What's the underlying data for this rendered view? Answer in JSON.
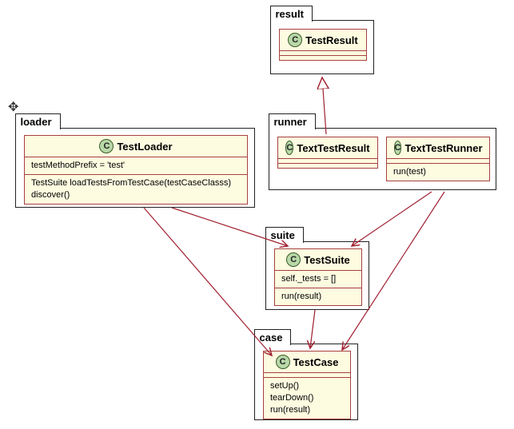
{
  "packages": {
    "result": {
      "label": "result"
    },
    "loader": {
      "label": "loader"
    },
    "runner": {
      "label": "runner"
    },
    "suite": {
      "label": "suite"
    },
    "case": {
      "label": "case"
    }
  },
  "classes": {
    "TestResult": {
      "name": "TestResult",
      "icon": "C"
    },
    "TestLoader": {
      "name": "TestLoader",
      "icon": "C",
      "attrs": [
        "testMethodPrefix = 'test'"
      ],
      "ops": [
        "TestSuite loadTestsFromTestCase(testCaseClasss)",
        "discover()"
      ]
    },
    "TextTestResult": {
      "name": "TextTestResult",
      "icon": "C"
    },
    "TextTestRunner": {
      "name": "TextTestRunner",
      "icon": "C",
      "ops": [
        "run(test)"
      ]
    },
    "TestSuite": {
      "name": "TestSuite",
      "icon": "C",
      "attrs": [
        "self._tests = []"
      ],
      "ops": [
        "run(result)"
      ]
    },
    "TestCase": {
      "name": "TestCase",
      "icon": "C",
      "ops": [
        "setUp()",
        "tearDown()",
        "run(result)"
      ]
    }
  },
  "relations": [
    {
      "from": "TextTestResult",
      "to": "TestResult",
      "type": "generalization"
    },
    {
      "from": "TestLoader",
      "to": "TestSuite",
      "type": "association"
    },
    {
      "from": "TestLoader",
      "to": "TestCase",
      "type": "association"
    },
    {
      "from": "TextTestRunner",
      "to": "TestSuite",
      "type": "association"
    },
    {
      "from": "TextTestRunner",
      "to": "TestCase",
      "type": "association"
    },
    {
      "from": "TestSuite",
      "to": "TestCase",
      "type": "association"
    }
  ],
  "chart_data": {
    "type": "uml-class-diagram",
    "packages": [
      {
        "name": "result",
        "classes": [
          "TestResult"
        ]
      },
      {
        "name": "loader",
        "classes": [
          "TestLoader"
        ]
      },
      {
        "name": "runner",
        "classes": [
          "TextTestResult",
          "TextTestRunner"
        ]
      },
      {
        "name": "suite",
        "classes": [
          "TestSuite"
        ]
      },
      {
        "name": "case",
        "classes": [
          "TestCase"
        ]
      }
    ],
    "classes": [
      {
        "name": "TestResult",
        "attributes": [],
        "operations": []
      },
      {
        "name": "TestLoader",
        "attributes": [
          "testMethodPrefix = 'test'"
        ],
        "operations": [
          "TestSuite loadTestsFromTestCase(testCaseClasss)",
          "discover()"
        ]
      },
      {
        "name": "TextTestResult",
        "attributes": [],
        "operations": []
      },
      {
        "name": "TextTestRunner",
        "attributes": [],
        "operations": [
          "run(test)"
        ]
      },
      {
        "name": "TestSuite",
        "attributes": [
          "self._tests = []"
        ],
        "operations": [
          "run(result)"
        ]
      },
      {
        "name": "TestCase",
        "attributes": [],
        "operations": [
          "setUp()",
          "tearDown()",
          "run(result)"
        ]
      }
    ],
    "relations": [
      {
        "from": "TextTestResult",
        "to": "TestResult",
        "type": "generalization"
      },
      {
        "from": "TestLoader",
        "to": "TestSuite",
        "type": "association"
      },
      {
        "from": "TestLoader",
        "to": "TestCase",
        "type": "association"
      },
      {
        "from": "TextTestRunner",
        "to": "TestSuite",
        "type": "association"
      },
      {
        "from": "TextTestRunner",
        "to": "TestCase",
        "type": "association"
      },
      {
        "from": "TestSuite",
        "to": "TestCase",
        "type": "association"
      }
    ]
  }
}
